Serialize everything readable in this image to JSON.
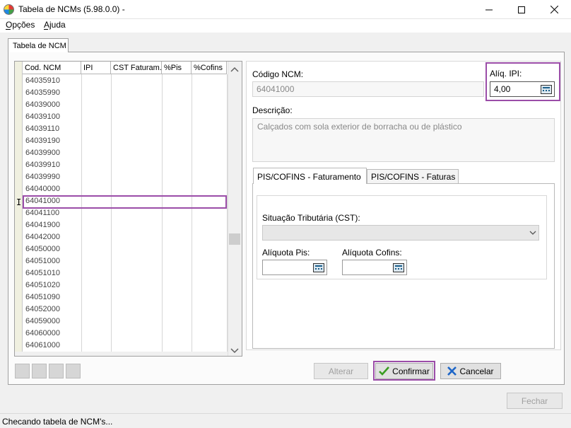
{
  "window": {
    "title": "Tabela de NCMs (5.98.0.0) -"
  },
  "menu": {
    "items": [
      {
        "label": "Opções"
      },
      {
        "label": "Ajuda"
      }
    ]
  },
  "main_tab": {
    "label": "Tabela de NCM"
  },
  "grid": {
    "columns": [
      "Cod. NCM",
      "IPI",
      "CST Faturam.",
      "%Pis",
      "%Cofins"
    ],
    "rows": [
      "64035910",
      "64035990",
      "64039000",
      "64039100",
      "64039110",
      "64039190",
      "64039900",
      "64039910",
      "64039990",
      "64040000",
      "64041000",
      "64041100",
      "64041900",
      "64042000",
      "64050000",
      "64051000",
      "64051010",
      "64051020",
      "64051090",
      "64052000",
      "64059000",
      "64060000",
      "64061000"
    ],
    "selected_row_marker": "I"
  },
  "form": {
    "codigo_label": "Código NCM:",
    "codigo_value": "64041000",
    "aliq_ipi_label": "Alíq. IPI:",
    "aliq_ipi_value": "4,00",
    "descricao_label": "Descrição:",
    "descricao_value": "Calçados com sola exterior de borracha ou de plástico"
  },
  "inner_tabs": [
    {
      "label": "PIS/COFINS - Faturamento"
    },
    {
      "label": "PIS/COFINS - Faturas"
    }
  ],
  "pis_cofins": {
    "cst_label": "Situação Tributária (CST):",
    "cst_value": "",
    "aliq_pis_label": "Alíquota Pis:",
    "aliq_pis_value": "",
    "aliq_cofins_label": "Alíquota Cofins:",
    "aliq_cofins_value": ""
  },
  "buttons": {
    "alterar": "Alterar",
    "confirmar": "Confirmar",
    "cancelar": "Cancelar",
    "fechar": "Fechar"
  },
  "status": {
    "text": "Checando tabela de NCM's..."
  },
  "colors": {
    "highlight": "#9b4da8",
    "confirm_icon": "#3a9d23",
    "cancel_icon": "#1e66c8"
  }
}
